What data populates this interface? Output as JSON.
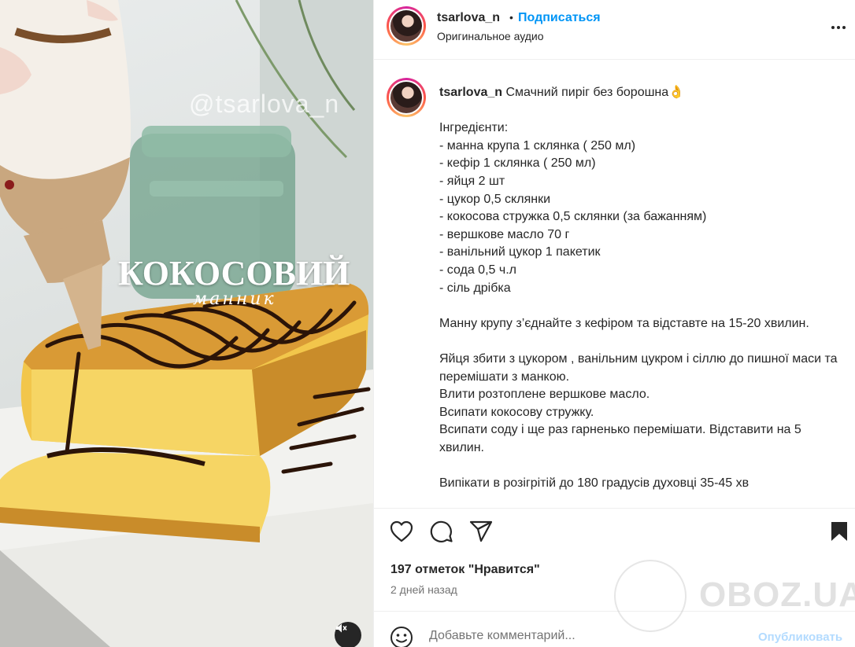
{
  "media": {
    "watermark": "@tsarlova_n",
    "overlay_title": "КОКОСОВИЙ",
    "overlay_subtitle": "манник",
    "mute_icon": "speaker-muted-icon"
  },
  "header": {
    "username": "tsarlova_n",
    "separator": "•",
    "follow_label": "Подписаться",
    "audio_label": "Оригинальное аудио",
    "more_icon": "more-horizontal-icon"
  },
  "caption": {
    "username": "tsarlova_n",
    "text": " Смачний пиріг без борошна👌\n\nІнгредієнти:\n- манна крупа 1 склянка ( 250 мл)\n- кефір 1 склянка ( 250 мл)\n- яйця 2 шт\n- цукор 0,5 склянки\n- кокосова стружка 0,5 склянки (за бажанням)\n- вершкове масло 70 г\n- ванільний цукор 1 пакетик\n- сода 0,5 ч.л\n- сіль дрібка\n\nМанну крупу з’єднайте з кефіром та відставте на 15-20 хвилин.\n\nЯйця збити з цукором , ванільним цукром і сіллю до пишної маси та перемішати з манкою.\nВлити розтоплене вершкове масло.\nВсипати кокосову стружку.\nВсипати соду і ще раз гарненько перемішати. Відставити на 5 хвилин.\n\nВипікати в розігрітій до 180 градусів духовці 35-45 хв"
  },
  "actions": {
    "like_icon": "heart-icon",
    "comment_icon": "comment-icon",
    "share_icon": "share-icon",
    "save_icon": "bookmark-icon"
  },
  "likes_text": "197 отметок \"Нравится\"",
  "time_text": "2 дней назад",
  "comment": {
    "emoji_icon": "emoji-icon",
    "placeholder": "Добавьте комментарий...",
    "publish_label": "Опубликовать"
  },
  "site_watermark": "OBOZ.UA",
  "colors": {
    "link_blue": "#0095f6",
    "publish_disabled": "#b3dbff",
    "text_primary": "#262626",
    "text_secondary": "#737373"
  }
}
